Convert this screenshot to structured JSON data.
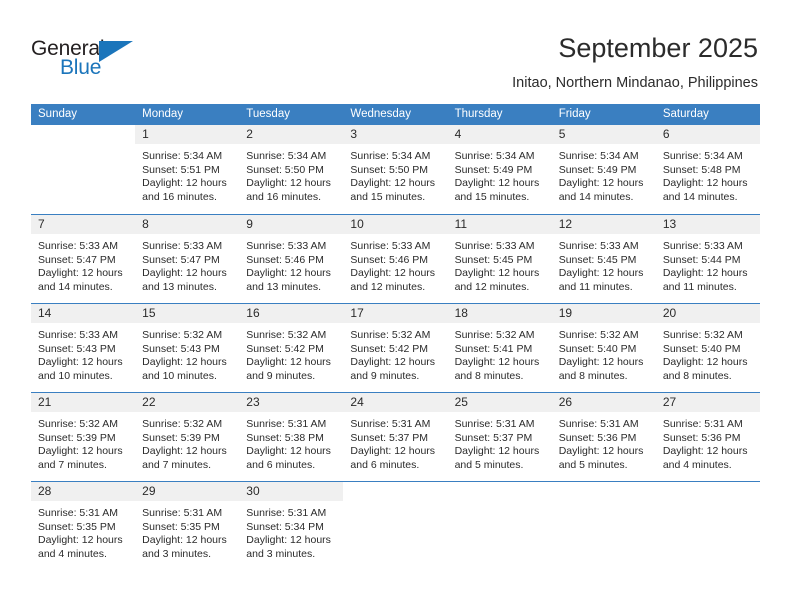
{
  "brand": {
    "name_part1": "General",
    "name_part2": "Blue",
    "triangle_icon": "triangle-icon",
    "accent_color": "#1b75bb"
  },
  "header": {
    "title": "September 2025",
    "subtitle": "Initao, Northern Mindanao, Philippines"
  },
  "calendar": {
    "header_color": "#3a7fc1",
    "daynum_band_color": "#f0f0f0",
    "day_names": [
      "Sunday",
      "Monday",
      "Tuesday",
      "Wednesday",
      "Thursday",
      "Friday",
      "Saturday"
    ],
    "weeks": [
      [
        {
          "day": "",
          "lines": []
        },
        {
          "day": "1",
          "lines": [
            "Sunrise: 5:34 AM",
            "Sunset: 5:51 PM",
            "Daylight: 12 hours",
            "and 16 minutes."
          ]
        },
        {
          "day": "2",
          "lines": [
            "Sunrise: 5:34 AM",
            "Sunset: 5:50 PM",
            "Daylight: 12 hours",
            "and 16 minutes."
          ]
        },
        {
          "day": "3",
          "lines": [
            "Sunrise: 5:34 AM",
            "Sunset: 5:50 PM",
            "Daylight: 12 hours",
            "and 15 minutes."
          ]
        },
        {
          "day": "4",
          "lines": [
            "Sunrise: 5:34 AM",
            "Sunset: 5:49 PM",
            "Daylight: 12 hours",
            "and 15 minutes."
          ]
        },
        {
          "day": "5",
          "lines": [
            "Sunrise: 5:34 AM",
            "Sunset: 5:49 PM",
            "Daylight: 12 hours",
            "and 14 minutes."
          ]
        },
        {
          "day": "6",
          "lines": [
            "Sunrise: 5:34 AM",
            "Sunset: 5:48 PM",
            "Daylight: 12 hours",
            "and 14 minutes."
          ]
        }
      ],
      [
        {
          "day": "7",
          "lines": [
            "Sunrise: 5:33 AM",
            "Sunset: 5:47 PM",
            "Daylight: 12 hours",
            "and 14 minutes."
          ]
        },
        {
          "day": "8",
          "lines": [
            "Sunrise: 5:33 AM",
            "Sunset: 5:47 PM",
            "Daylight: 12 hours",
            "and 13 minutes."
          ]
        },
        {
          "day": "9",
          "lines": [
            "Sunrise: 5:33 AM",
            "Sunset: 5:46 PM",
            "Daylight: 12 hours",
            "and 13 minutes."
          ]
        },
        {
          "day": "10",
          "lines": [
            "Sunrise: 5:33 AM",
            "Sunset: 5:46 PM",
            "Daylight: 12 hours",
            "and 12 minutes."
          ]
        },
        {
          "day": "11",
          "lines": [
            "Sunrise: 5:33 AM",
            "Sunset: 5:45 PM",
            "Daylight: 12 hours",
            "and 12 minutes."
          ]
        },
        {
          "day": "12",
          "lines": [
            "Sunrise: 5:33 AM",
            "Sunset: 5:45 PM",
            "Daylight: 12 hours",
            "and 11 minutes."
          ]
        },
        {
          "day": "13",
          "lines": [
            "Sunrise: 5:33 AM",
            "Sunset: 5:44 PM",
            "Daylight: 12 hours",
            "and 11 minutes."
          ]
        }
      ],
      [
        {
          "day": "14",
          "lines": [
            "Sunrise: 5:33 AM",
            "Sunset: 5:43 PM",
            "Daylight: 12 hours",
            "and 10 minutes."
          ]
        },
        {
          "day": "15",
          "lines": [
            "Sunrise: 5:32 AM",
            "Sunset: 5:43 PM",
            "Daylight: 12 hours",
            "and 10 minutes."
          ]
        },
        {
          "day": "16",
          "lines": [
            "Sunrise: 5:32 AM",
            "Sunset: 5:42 PM",
            "Daylight: 12 hours",
            "and 9 minutes."
          ]
        },
        {
          "day": "17",
          "lines": [
            "Sunrise: 5:32 AM",
            "Sunset: 5:42 PM",
            "Daylight: 12 hours",
            "and 9 minutes."
          ]
        },
        {
          "day": "18",
          "lines": [
            "Sunrise: 5:32 AM",
            "Sunset: 5:41 PM",
            "Daylight: 12 hours",
            "and 8 minutes."
          ]
        },
        {
          "day": "19",
          "lines": [
            "Sunrise: 5:32 AM",
            "Sunset: 5:40 PM",
            "Daylight: 12 hours",
            "and 8 minutes."
          ]
        },
        {
          "day": "20",
          "lines": [
            "Sunrise: 5:32 AM",
            "Sunset: 5:40 PM",
            "Daylight: 12 hours",
            "and 8 minutes."
          ]
        }
      ],
      [
        {
          "day": "21",
          "lines": [
            "Sunrise: 5:32 AM",
            "Sunset: 5:39 PM",
            "Daylight: 12 hours",
            "and 7 minutes."
          ]
        },
        {
          "day": "22",
          "lines": [
            "Sunrise: 5:32 AM",
            "Sunset: 5:39 PM",
            "Daylight: 12 hours",
            "and 7 minutes."
          ]
        },
        {
          "day": "23",
          "lines": [
            "Sunrise: 5:31 AM",
            "Sunset: 5:38 PM",
            "Daylight: 12 hours",
            "and 6 minutes."
          ]
        },
        {
          "day": "24",
          "lines": [
            "Sunrise: 5:31 AM",
            "Sunset: 5:37 PM",
            "Daylight: 12 hours",
            "and 6 minutes."
          ]
        },
        {
          "day": "25",
          "lines": [
            "Sunrise: 5:31 AM",
            "Sunset: 5:37 PM",
            "Daylight: 12 hours",
            "and 5 minutes."
          ]
        },
        {
          "day": "26",
          "lines": [
            "Sunrise: 5:31 AM",
            "Sunset: 5:36 PM",
            "Daylight: 12 hours",
            "and 5 minutes."
          ]
        },
        {
          "day": "27",
          "lines": [
            "Sunrise: 5:31 AM",
            "Sunset: 5:36 PM",
            "Daylight: 12 hours",
            "and 4 minutes."
          ]
        }
      ],
      [
        {
          "day": "28",
          "lines": [
            "Sunrise: 5:31 AM",
            "Sunset: 5:35 PM",
            "Daylight: 12 hours",
            "and 4 minutes."
          ]
        },
        {
          "day": "29",
          "lines": [
            "Sunrise: 5:31 AM",
            "Sunset: 5:35 PM",
            "Daylight: 12 hours",
            "and 3 minutes."
          ]
        },
        {
          "day": "30",
          "lines": [
            "Sunrise: 5:31 AM",
            "Sunset: 5:34 PM",
            "Daylight: 12 hours",
            "and 3 minutes."
          ]
        },
        {
          "day": "",
          "lines": []
        },
        {
          "day": "",
          "lines": []
        },
        {
          "day": "",
          "lines": []
        },
        {
          "day": "",
          "lines": []
        }
      ]
    ]
  }
}
